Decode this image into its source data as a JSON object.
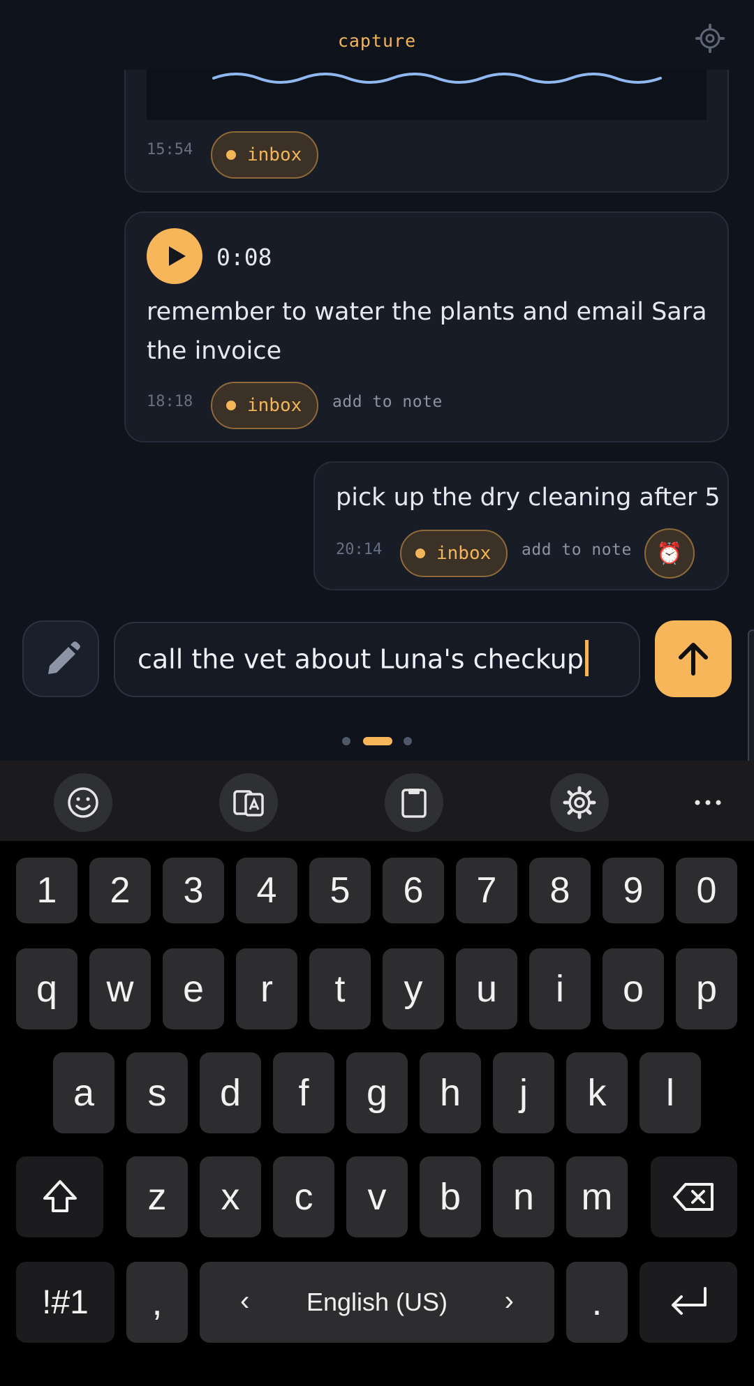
{
  "header": {
    "title": "capture",
    "settings_icon": "settings-gear-icon"
  },
  "notes": [
    {
      "time": "15:54",
      "tag": "inbox"
    },
    {
      "time": "18:18",
      "tag": "inbox",
      "duration": "0:08",
      "text_line1": "remember to water the plants and email Sara",
      "text_line2": "the invoice",
      "add_note": "add to note"
    },
    {
      "time": "20:14",
      "tag": "inbox",
      "text": "pick up the dry cleaning after 5",
      "add_note": "add to note",
      "alarm_icon": "⏰"
    }
  ],
  "composer": {
    "value": "call the vet about Luna's checkup"
  },
  "colors": {
    "accent": "#f7b659",
    "background": "#0f131c",
    "card": "#171c26"
  },
  "keyboard": {
    "toolbar": [
      "emoji-icon",
      "translate-icon",
      "clipboard-icon",
      "settings-icon",
      "more-icon"
    ],
    "numbers": [
      "1",
      "2",
      "3",
      "4",
      "5",
      "6",
      "7",
      "8",
      "9",
      "0"
    ],
    "row1": [
      "q",
      "w",
      "e",
      "r",
      "t",
      "y",
      "u",
      "i",
      "o",
      "p"
    ],
    "row2": [
      "a",
      "s",
      "d",
      "f",
      "g",
      "h",
      "j",
      "k",
      "l"
    ],
    "row3": [
      "z",
      "x",
      "c",
      "v",
      "b",
      "n",
      "m"
    ],
    "symbols": "!#1",
    "comma": ",",
    "language": "English (US)",
    "period": "."
  }
}
